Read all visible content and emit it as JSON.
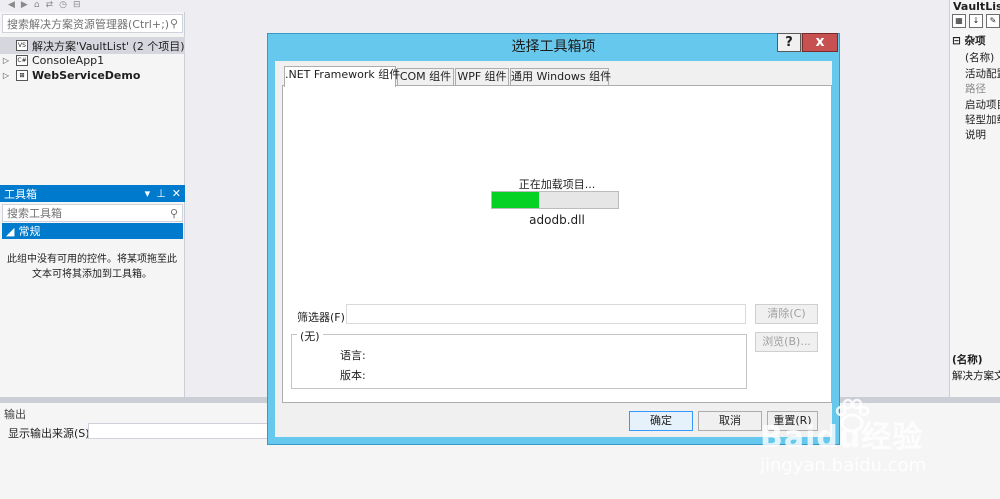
{
  "solution_explorer": {
    "search_placeholder": "搜索解决方案资源管理器(Ctrl+;)",
    "solution_label": "解决方案'VaultList' (2 个项目)",
    "projects": [
      "ConsoleApp1",
      "WebServiceDemo"
    ],
    "project_icons": [
      "csharp-project-icon",
      "web-project-icon"
    ]
  },
  "toolbox": {
    "title": "工具箱",
    "search_placeholder": "搜索工具箱",
    "group_label": "常规",
    "empty_message": "此组中没有可用的控件。将某项拖至此文本可将其添加到工具箱。"
  },
  "properties": {
    "title": "VaultList",
    "category": "杂项",
    "items": [
      "(名称)",
      "活动配置",
      "路径",
      "启动项目",
      "轻型加载",
      "说明"
    ],
    "footer_name": "(名称)",
    "footer_desc": "解决方案文件"
  },
  "output": {
    "title": "输出",
    "source_label": "显示输出来源(S):"
  },
  "dialog": {
    "title": "选择工具箱项",
    "help_label": "?",
    "close_label": "x",
    "tabs": [
      ".NET Framework 组件",
      "COM 组件",
      "WPF 组件",
      "通用 Windows 组件"
    ],
    "loading_text": "正在加载项目...",
    "loading_file": "adodb.dll",
    "progress": 0.37,
    "filter_label": "筛选器(F):",
    "clear_label": "清除(C)",
    "browse_label": "浏览(B)...",
    "info_legend": "(无)",
    "language_label": "语言:",
    "version_label": "版本:",
    "ok_label": "确定",
    "cancel_label": "取消",
    "reset_label": "重置(R)"
  },
  "watermark": {
    "brand": "Baidu经验",
    "url": "jingyan.baidu.com"
  },
  "colors": {
    "accent": "#007acc",
    "dialog_frame": "#66c8ec",
    "close_button": "#c75050",
    "progress_fill": "#06d125"
  }
}
